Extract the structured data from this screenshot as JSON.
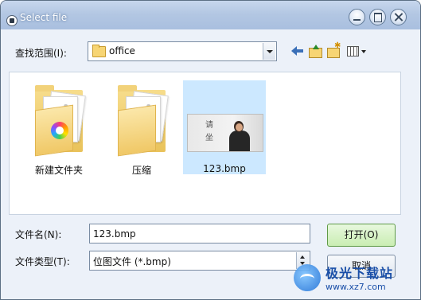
{
  "window": {
    "title": "Select file"
  },
  "toolbar": {
    "look_in_label": "查找范围(I):",
    "look_in_value": "office",
    "buttons": [
      "back-icon",
      "up-folder-icon",
      "new-folder-icon",
      "view-menu-icon"
    ]
  },
  "files": [
    {
      "name": "新建文件夹",
      "type": "folder",
      "selected": false
    },
    {
      "name": "压缩",
      "type": "folder",
      "selected": false
    },
    {
      "name": "123.bmp",
      "type": "image",
      "selected": true,
      "thumbnail_text": "请坐"
    }
  ],
  "form": {
    "filename_label": "文件名(N):",
    "filename_value": "123.bmp",
    "filetype_label": "文件类型(T):",
    "filetype_value": "位图文件 (*.bmp)",
    "open_label": "打开(O)",
    "cancel_label": "取消"
  },
  "watermark": {
    "title": "极光下载站",
    "url": "www.xz7.com"
  }
}
